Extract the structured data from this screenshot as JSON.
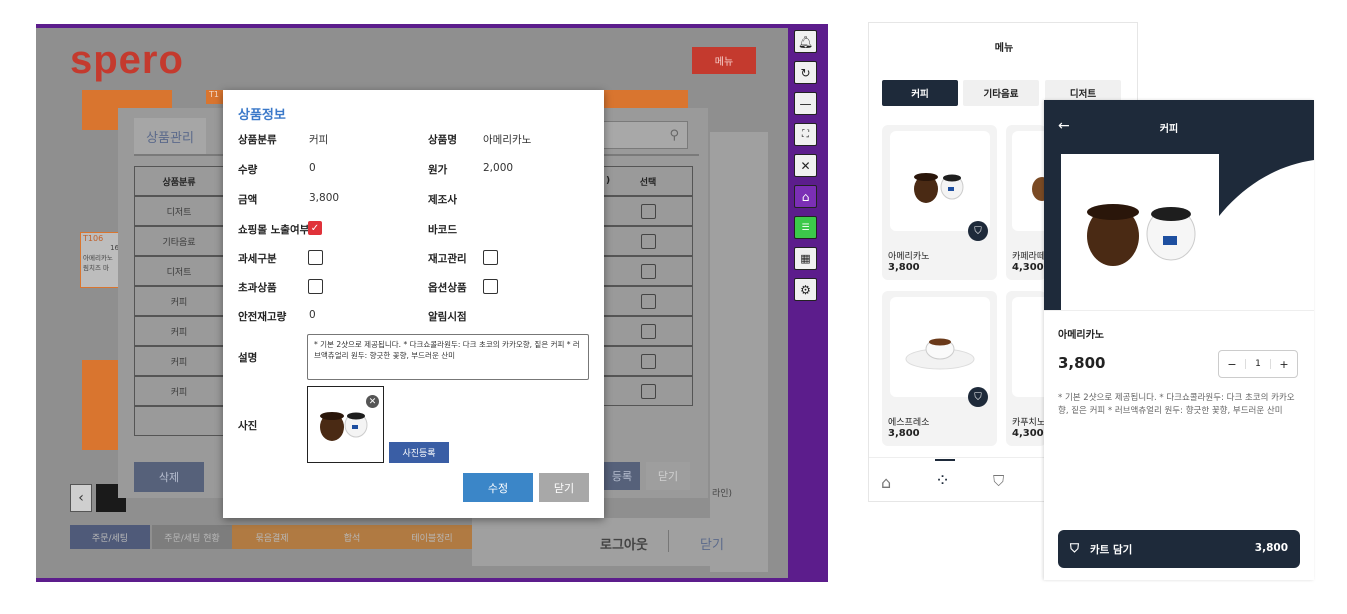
{
  "pos": {
    "logo": "spero",
    "menu_label": "메뉴",
    "tile_left_header": "T106",
    "tile_left_count": "16",
    "tile_left_line1": "아메리카노",
    "tile_left_line2": "림치즈 마",
    "tile_top_header": "T1",
    "bottom_tabs": [
      "주문/세팅",
      "주문/세팅 현황",
      "묶음결제",
      "합석",
      "테이블정리"
    ],
    "footer_logout": "로그아웃",
    "footer_close": "닫기",
    "right_edge_text": "라인)",
    "product_manager": {
      "tab_label": "상품관리",
      "col_category": "상품분류",
      "col_select": "선택",
      "col_partial": ")",
      "rows": [
        "디저트",
        "기타음료",
        "디저트",
        "커피",
        "커피",
        "커피",
        "커피"
      ],
      "delete_label": "삭제",
      "register_label": "등록",
      "close_label": "닫기"
    }
  },
  "modal": {
    "title": "상품정보",
    "fields": {
      "category_label": "상품분류",
      "category_value": "커피",
      "name_label": "상품명",
      "name_value": "아메리카노",
      "qty_label": "수량",
      "qty_value": "0",
      "cost_label": "원가",
      "cost_value": "2,000",
      "price_label": "금액",
      "price_value": "3,800",
      "maker_label": "제조사",
      "shop_label": "쇼핑몰 노출여부",
      "barcode_label": "바코드",
      "tax_label": "과세구분",
      "stock_label": "재고관리",
      "excess_label": "초과상품",
      "option_label": "옵션상품",
      "safety_label": "안전재고량",
      "safety_value": "0",
      "alert_label": "알림시점",
      "desc_label": "설명",
      "desc_value": "* 기본 2샷으로 제공됩니다. * 다크쇼콜라원두: 다크 초코의 카카오향, 짙은 커피 * 러브액츄얼리 원두: 향긋한 꽃향, 부드러운 산미",
      "photo_label": "사진"
    },
    "photo_button": "사진등록",
    "edit_button": "수정",
    "close_button": "닫기"
  },
  "toolbar": {
    "icons": [
      "bell-icon",
      "refresh-icon",
      "minimize-icon",
      "fullscreen-icon",
      "close-icon",
      "home-icon",
      "list-icon",
      "grid-icon",
      "gear-icon"
    ],
    "colors": [
      "#f0f0f0",
      "#f0f0f0",
      "#f0f0f0",
      "#f0f0f0",
      "#f0f0f0",
      "#7b2fb5",
      "#3cc94a",
      "#f0f0f0",
      "#f0f0f0"
    ]
  },
  "app": {
    "header": "메뉴",
    "tabs": [
      "커피",
      "기타음료",
      "디저트"
    ],
    "products": [
      {
        "name": "아메리카노",
        "price": "3,800"
      },
      {
        "name": "카페라떼",
        "price": "4,300"
      },
      {
        "name": "에스프레소",
        "price": "3,800"
      },
      {
        "name": "카푸치노",
        "price": "4,300"
      }
    ]
  },
  "detail": {
    "title": "커피",
    "name": "아메리카노",
    "price": "3,800",
    "qty": "1",
    "minus": "−",
    "plus": "+",
    "description": "* 기본 2샷으로 제공됩니다. * 다크쇼콜라원두: 다크 초코의 카카오향, 짙은 커피 * 러브액츄얼리 원두: 향긋한 꽃향, 부드러운 산미",
    "cart_label": "카트 담기",
    "cart_price": "3,800"
  }
}
